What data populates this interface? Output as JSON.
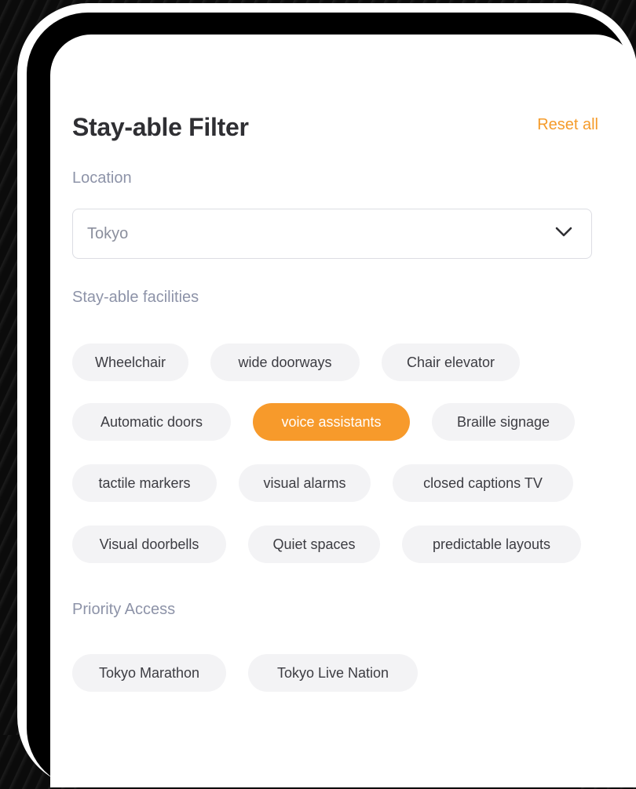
{
  "header": {
    "title": "Stay-able Filter",
    "reset_label": "Reset all"
  },
  "location": {
    "label": "Location",
    "selected": "Tokyo"
  },
  "facilities": {
    "label": "Stay-able facilities",
    "chips": [
      {
        "label": "Wheelchair",
        "active": false
      },
      {
        "label": "wide doorways",
        "active": false
      },
      {
        "label": "Chair elevator",
        "active": false
      },
      {
        "label": "Automatic doors",
        "active": false
      },
      {
        "label": "voice assistants",
        "active": true
      },
      {
        "label": "Braille signage",
        "active": false
      },
      {
        "label": "tactile markers",
        "active": false
      },
      {
        "label": "visual alarms",
        "active": false
      },
      {
        "label": "closed captions TV",
        "active": false
      },
      {
        "label": "Visual doorbells",
        "active": false
      },
      {
        "label": "Quiet spaces",
        "active": false
      },
      {
        "label": "predictable layouts",
        "active": false
      }
    ]
  },
  "priority": {
    "label": "Priority Access",
    "chips": [
      {
        "label": "Tokyo Marathon",
        "active": false
      },
      {
        "label": "Tokyo Live Nation",
        "active": false
      }
    ]
  },
  "colors": {
    "accent": "#f79a2b",
    "chip_bg": "#f3f3f5",
    "label_gray": "#8d93a8"
  },
  "icons": {
    "dropdown": "chevron-down-icon"
  }
}
